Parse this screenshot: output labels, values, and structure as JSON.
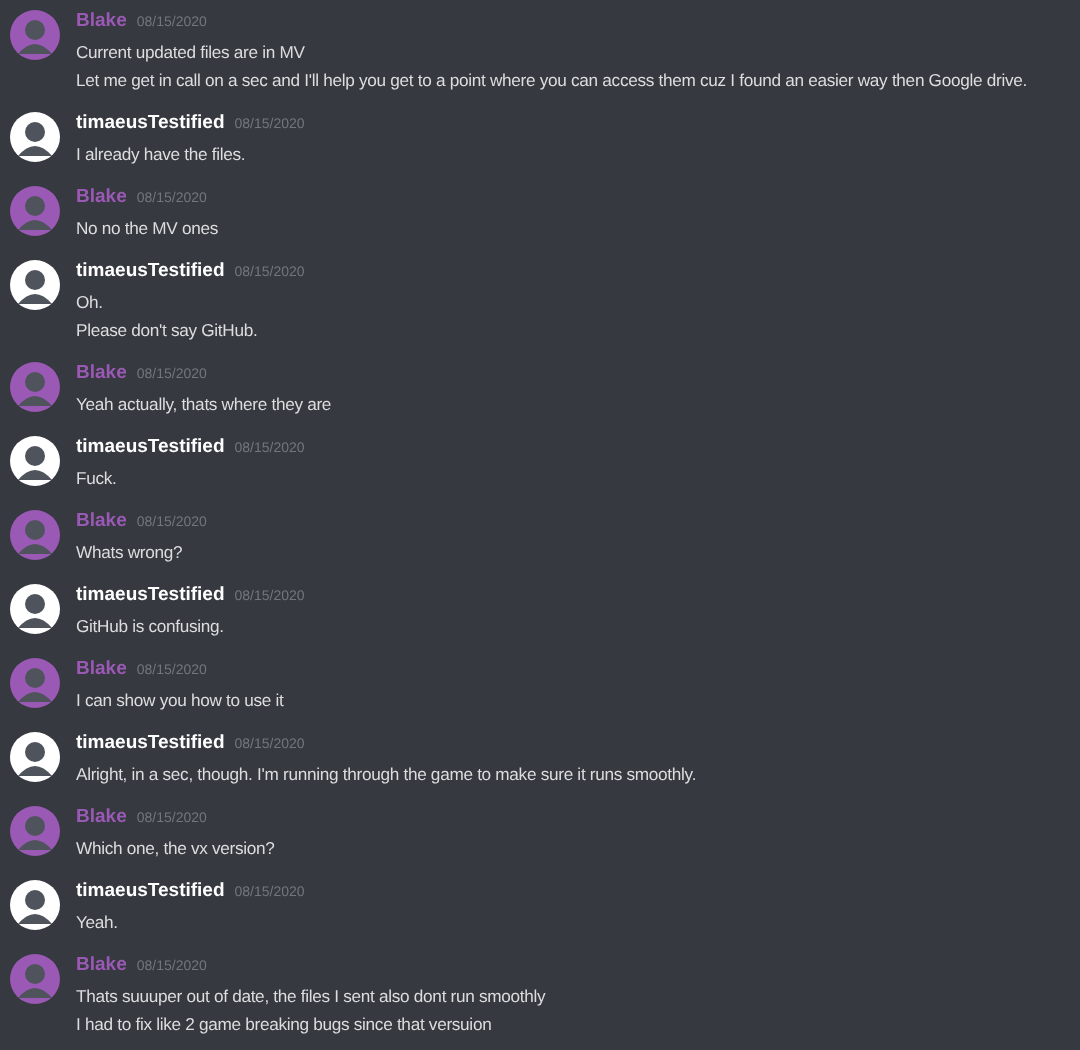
{
  "messages": [
    {
      "author": "Blake",
      "color": "#9b59b6",
      "time": "08/15/2020",
      "lines": [
        "Current updated files are in MV",
        "Let me get in call on a sec and I'll help you get to a point where you can access them cuz I found an easier way then Google drive."
      ]
    },
    {
      "author": "timaeusTestified",
      "color": "#ffffff",
      "time": "08/15/2020",
      "lines": [
        "I already have the files."
      ]
    },
    {
      "author": "Blake",
      "color": "#9b59b6",
      "time": "08/15/2020",
      "lines": [
        "No no the MV ones"
      ]
    },
    {
      "author": "timaeusTestified",
      "color": "#ffffff",
      "time": "08/15/2020",
      "lines": [
        "Oh.",
        "Please don't say GitHub."
      ]
    },
    {
      "author": "Blake",
      "color": "#9b59b6",
      "time": "08/15/2020",
      "lines": [
        "Yeah actually, thats where they are"
      ]
    },
    {
      "author": "timaeusTestified",
      "color": "#ffffff",
      "time": "08/15/2020",
      "lines": [
        "Fuck."
      ]
    },
    {
      "author": "Blake",
      "color": "#9b59b6",
      "time": "08/15/2020",
      "lines": [
        "Whats wrong?"
      ]
    },
    {
      "author": "timaeusTestified",
      "color": "#ffffff",
      "time": "08/15/2020",
      "lines": [
        "GitHub is confusing."
      ]
    },
    {
      "author": "Blake",
      "color": "#9b59b6",
      "time": "08/15/2020",
      "lines": [
        "I can show you how to use it"
      ]
    },
    {
      "author": "timaeusTestified",
      "color": "#ffffff",
      "time": "08/15/2020",
      "lines": [
        "Alright, in a sec, though. I'm running through the game to make sure it runs smoothly."
      ]
    },
    {
      "author": "Blake",
      "color": "#9b59b6",
      "time": "08/15/2020",
      "lines": [
        "Which one, the vx version?"
      ]
    },
    {
      "author": "timaeusTestified",
      "color": "#ffffff",
      "time": "08/15/2020",
      "lines": [
        "Yeah."
      ]
    },
    {
      "author": "Blake",
      "color": "#9b59b6",
      "time": "08/15/2020",
      "lines": [
        "Thats suuuper out of date, the files I sent also dont run smoothly",
        "I had to fix like 2 game breaking bugs since that versuion"
      ]
    }
  ]
}
